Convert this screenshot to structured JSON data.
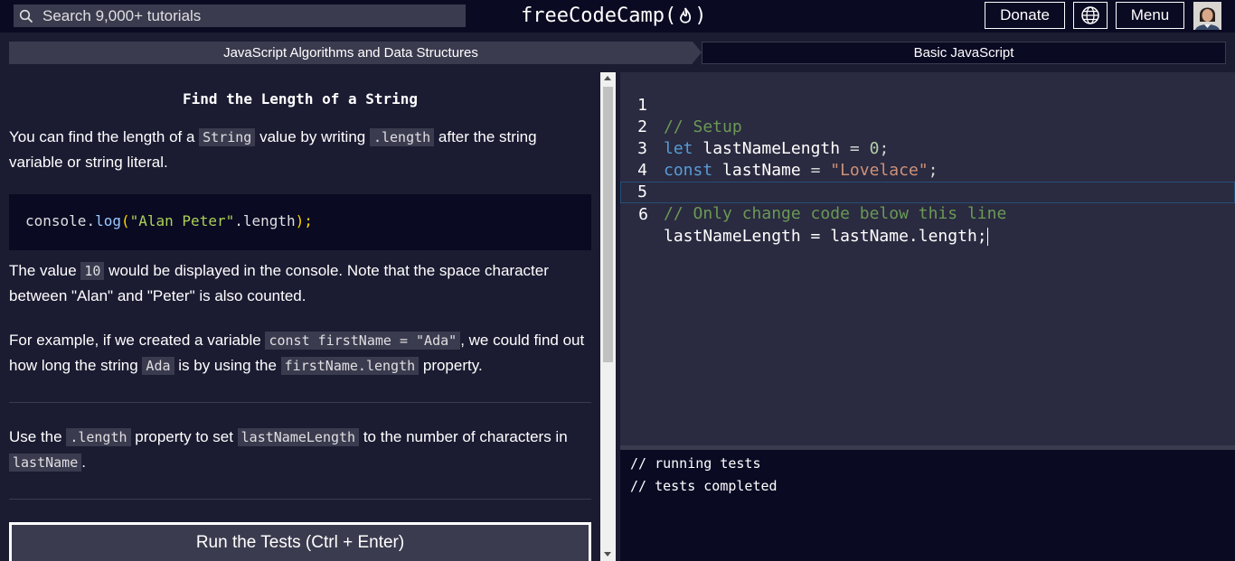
{
  "header": {
    "search_placeholder": "Search 9,000+ tutorials",
    "logo_text_left": "freeCodeCamp(",
    "logo_text_right": ")",
    "donate_label": "Donate",
    "menu_label": "Menu",
    "icons": [
      "search-icon",
      "fire-icon",
      "globe-icon",
      "avatar"
    ]
  },
  "breadcrumb": {
    "superblock": "JavaScript Algorithms and Data Structures",
    "block": "Basic JavaScript"
  },
  "instructions": {
    "title": "Find the Length of a String",
    "p1": {
      "t1": "You can find the length of a ",
      "c1": "String",
      "t2": " value by writing ",
      "c2": ".length",
      "t3": " after the string variable or string literal."
    },
    "example_code": {
      "obj": "console",
      "dot": ".",
      "fn": "log",
      "open": "(",
      "str": "\"Alan Peter\"",
      "rest": ".length",
      "close": ");"
    },
    "p2": {
      "t1": "The value ",
      "c1": "10",
      "t2": " would be displayed in the console. Note that the space character between \"Alan\" and \"Peter\" is also counted."
    },
    "p3": {
      "t1": "For example, if we created a variable ",
      "c1": "const firstName = \"Ada\"",
      "t2": ", we could find out how long the string ",
      "c2": "Ada",
      "t3": " is by using the ",
      "c3": "firstName.length",
      "t4": " property."
    },
    "p4": {
      "t1": "Use the ",
      "c1": ".length",
      "t2": " property to set ",
      "c2": "lastNameLength",
      "t3": " to the number of characters in ",
      "c3": "lastName",
      "t4": "."
    },
    "run_button": "Run the Tests (Ctrl + Enter)"
  },
  "editor": {
    "line_numbers": [
      "1",
      "2",
      "3",
      "4",
      "5",
      "6"
    ],
    "l1": "// Setup",
    "l2": {
      "kw": "let",
      "name": "lastNameLength",
      "op": " = ",
      "num": "0",
      "end": ";"
    },
    "l3": {
      "kw": "const",
      "name": "lastName",
      "op": " = ",
      "str": "\"Lovelace\"",
      "end": ";"
    },
    "l5": "// Only change code below this line",
    "l6": "lastNameLength = lastName.length;"
  },
  "console": {
    "lines": [
      "// running tests",
      "// tests completed"
    ]
  }
}
